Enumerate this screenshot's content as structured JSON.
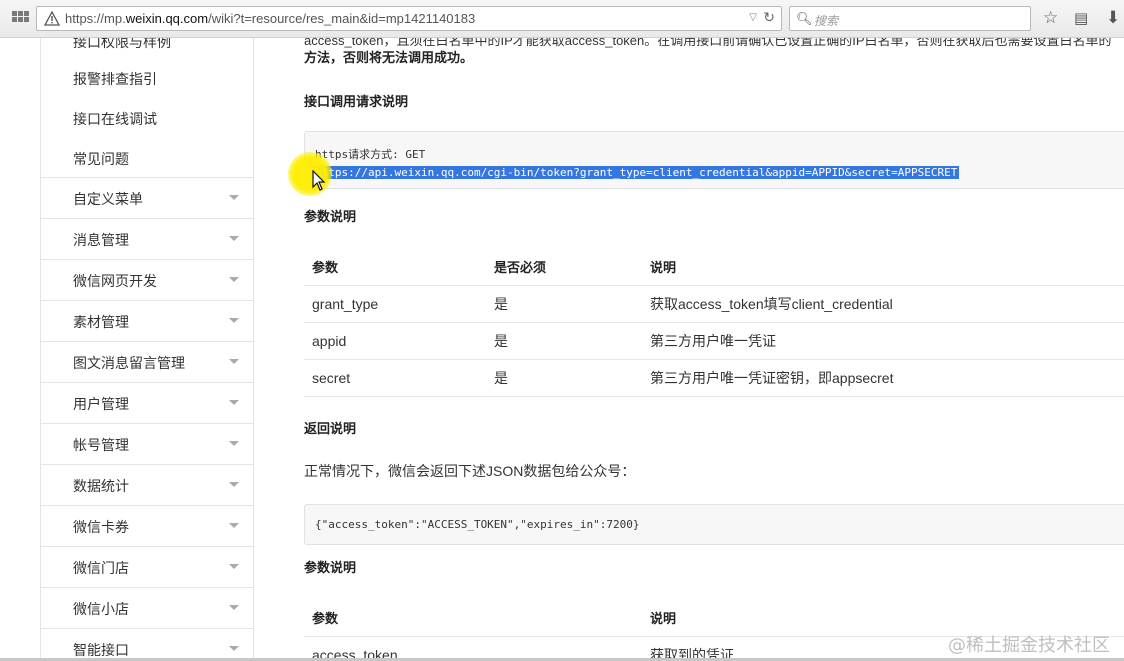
{
  "browser": {
    "url_prefix": "https://mp.",
    "url_host": "weixin.qq.com",
    "url_suffix": "/wiki?t=resource/res_main&id=mp1421140183",
    "search_placeholder": "搜索"
  },
  "sidebar": {
    "items": [
      {
        "label": "接口权限与样例"
      },
      {
        "label": "报警排查指引"
      },
      {
        "label": "接口在线调试"
      },
      {
        "label": "常见问题"
      },
      {
        "label": "自定义菜单"
      },
      {
        "label": "消息管理"
      },
      {
        "label": "微信网页开发"
      },
      {
        "label": "素材管理"
      },
      {
        "label": "图文消息留言管理"
      },
      {
        "label": "用户管理"
      },
      {
        "label": "帐号管理"
      },
      {
        "label": "数据统计"
      },
      {
        "label": "微信卡券"
      },
      {
        "label": "微信门店"
      },
      {
        "label": "微信小店"
      },
      {
        "label": "智能接口"
      }
    ]
  },
  "content": {
    "clipped_line": "access_token，且须在白名单中的IP才能获取access_token。在调用接口前请确认已设置正确的IP白名单，否则在获取后也需要设置白名单的",
    "warning_tail": "方法，否则将无法调用成功。",
    "request_heading": "接口调用请求说明",
    "request_method": "https请求方式: GET",
    "request_url": "https://api.weixin.qq.com/cgi-bin/token?grant_type=client_credential&appid=APPID&secret=APPSECRET",
    "params_heading": "参数说明",
    "params_table": {
      "headers": [
        "参数",
        "是否必须",
        "说明"
      ],
      "rows": [
        [
          "grant_type",
          "是",
          "获取access_token填写client_credential"
        ],
        [
          "appid",
          "是",
          "第三方用户唯一凭证"
        ],
        [
          "secret",
          "是",
          "第三方用户唯一凭证密钥，即appsecret"
        ]
      ]
    },
    "return_heading": "返回说明",
    "return_text": "正常情况下，微信会返回下述JSON数据包给公众号：",
    "return_json": "{\"access_token\":\"ACCESS_TOKEN\",\"expires_in\":7200}",
    "params_heading_2": "参数说明",
    "params_table_2": {
      "headers": [
        "参数",
        "说明"
      ],
      "rows": [
        [
          "access_token",
          "获取到的凭证"
        ]
      ]
    }
  },
  "watermark": "@稀土掘金技术社区"
}
